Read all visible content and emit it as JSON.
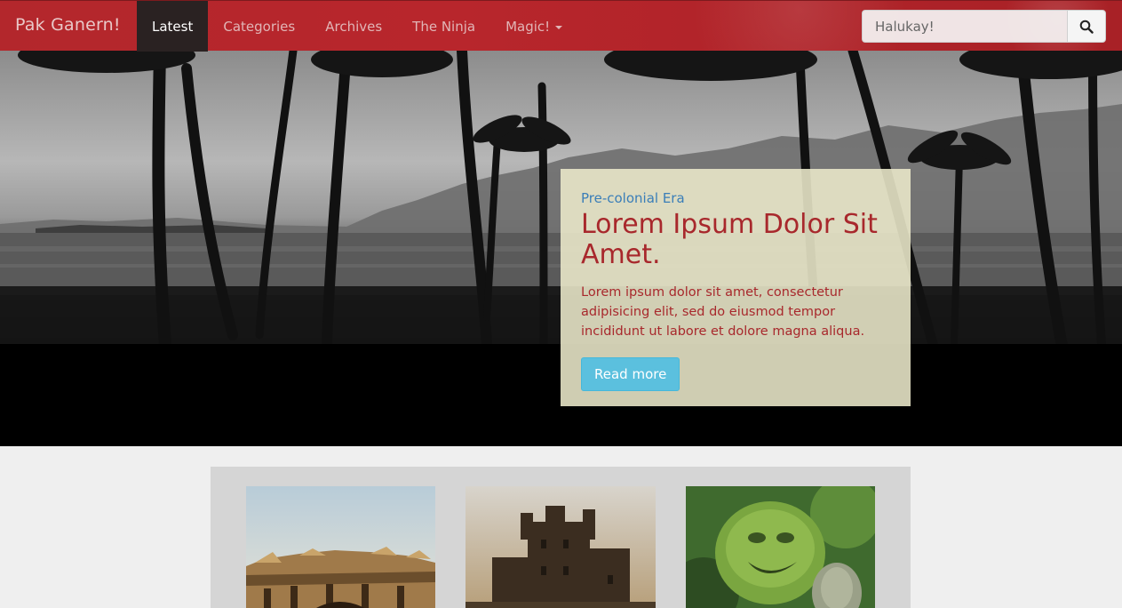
{
  "navbar": {
    "brand": "Pak Ganern!",
    "items": [
      {
        "label": "Latest",
        "active": true
      },
      {
        "label": "Categories",
        "active": false
      },
      {
        "label": "Archives",
        "active": false
      },
      {
        "label": "The Ninja",
        "active": false
      },
      {
        "label": "Magic!",
        "active": false,
        "dropdown": true
      }
    ],
    "search": {
      "placeholder": "Halukay!",
      "icon": "search-icon"
    }
  },
  "hero": {
    "category": "Pre-colonial Era",
    "title": "Lorem Ipsum Dolor Sit Amet.",
    "text": "Lorem ipsum dolor sit amet, consectetur adipisicing elit, sed do eiusmod tempor incididunt ut labore et dolore magna aliqua.",
    "button_label": "Read more"
  },
  "gallery": {
    "thumbnails": [
      {
        "subject": "ornate-building-facade"
      },
      {
        "subject": "stone-castle"
      },
      {
        "subject": "moss-covered-statue"
      }
    ]
  },
  "colors": {
    "navbar": "#b3272c",
    "active_nav": "#2a2222",
    "accent_red": "#a8282c",
    "link_blue": "#3a7eb8",
    "button": "#5bc0de"
  }
}
